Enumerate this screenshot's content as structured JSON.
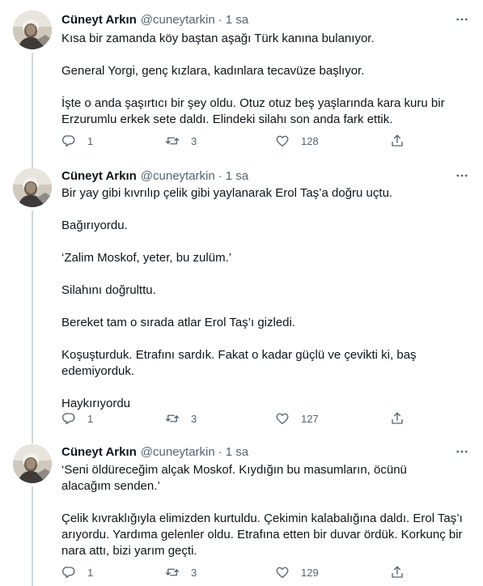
{
  "tweets": [
    {
      "name": "Cüneyt Arkın",
      "handle": "@cuneytarkin",
      "separator": "·",
      "time": "1 sa",
      "paragraphs": [
        "Kısa bir zamanda köy baştan aşağı Türk kanına bulanıyor.",
        "General Yorgi, genç kızlara, kadınlara tecavüze başlıyor.",
        "İşte o anda şaşırtıcı bir şey oldu. Otuz otuz beş yaşlarında kara kuru bir Erzurumlu erkek sete daldı. Elindeki silahı son anda fark ettik."
      ],
      "replies": "1",
      "retweets": "3",
      "likes": "128"
    },
    {
      "name": "Cüneyt Arkın",
      "handle": "@cuneytarkin",
      "separator": "·",
      "time": "1 sa",
      "paragraphs": [
        "Bir yay gibi kıvrılıp çelik gibi yaylanarak Erol Taş’a doğru uçtu.",
        "Bağırıyordu.",
        "‘Zalim Moskof, yeter, bu zulüm.’",
        "Silahını doğrulttu.",
        "Bereket tam o sırada atlar Erol Taş’ı gizledi.",
        "Koşuşturduk. Etrafını sardık. Fakat o kadar güçlü ve çevikti ki, baş edemiyorduk.",
        "Haykırıyordu"
      ],
      "replies": "1",
      "retweets": "3",
      "likes": "127"
    },
    {
      "name": "Cüneyt Arkın",
      "handle": "@cuneytarkin",
      "separator": "·",
      "time": "1 sa",
      "paragraphs": [
        "‘Seni öldüreceğim alçak Moskof. Kıydığın bu masumların, öcünü alacağım senden.’",
        "Çelik kıvraklığıyla elimizden kurtuldu. Çekimin kalabalığına daldı. Erol Taş’ı arıyordu. Yardıma gelenler oldu. Etrafına etten bir duvar ördük. Korkunç bir nara attı, bizi yarım geçti."
      ],
      "replies": "1",
      "retweets": "3",
      "likes": "129"
    }
  ],
  "icons": {
    "avatar": "profile-photo",
    "more": "more-horizontal-icon",
    "reply": "reply-icon",
    "retweet": "retweet-icon",
    "like": "heart-icon",
    "share": "share-icon"
  },
  "colors": {
    "text": "#0f1419",
    "muted": "#536471",
    "thread_line": "#cfd9de",
    "divider": "#eff3f4"
  }
}
